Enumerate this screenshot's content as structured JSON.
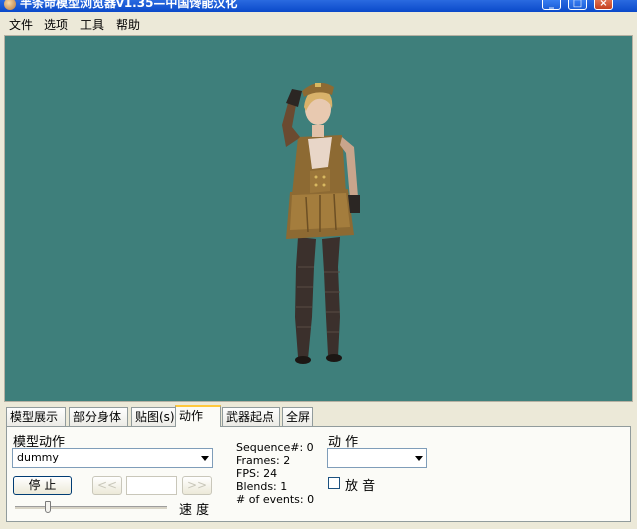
{
  "window": {
    "title": "半条命模型浏览器v1.35—中国馋能汉化",
    "minimize_glyph": "_",
    "maximize_glyph": "□",
    "close_glyph": "×"
  },
  "menu": {
    "items": [
      "文件",
      "选项",
      "工具",
      "帮助"
    ]
  },
  "tabs": [
    {
      "label": "模型展示"
    },
    {
      "label": "部分身体"
    },
    {
      "label": "贴图(s)"
    },
    {
      "label": "动作",
      "active": true
    },
    {
      "label": "武器起点"
    },
    {
      "label": "全屏"
    }
  ],
  "panel": {
    "sequence_group_label": "模型动作",
    "sequence_value": "dummy",
    "stop_label": "停 止",
    "prev_label": "<<",
    "next_label": ">>",
    "frame_value": "",
    "speed_label": "速 度",
    "speed_slider_level": 0.22,
    "stats": [
      "Sequence#: 0",
      "Frames: 2",
      "FPS: 24",
      "Blends: 1",
      "# of events: 0"
    ],
    "action_group_label": "动 作",
    "action_value": "",
    "sound_label": "放 音",
    "sound_checked": false
  },
  "colors": {
    "viewport_background": "#3e7f7b",
    "titlebar": "#0a49c9",
    "active_tab_accent": "#ffc83c"
  },
  "icons": {
    "app": "app-head-icon",
    "dropdown": "chevron-down-icon"
  }
}
